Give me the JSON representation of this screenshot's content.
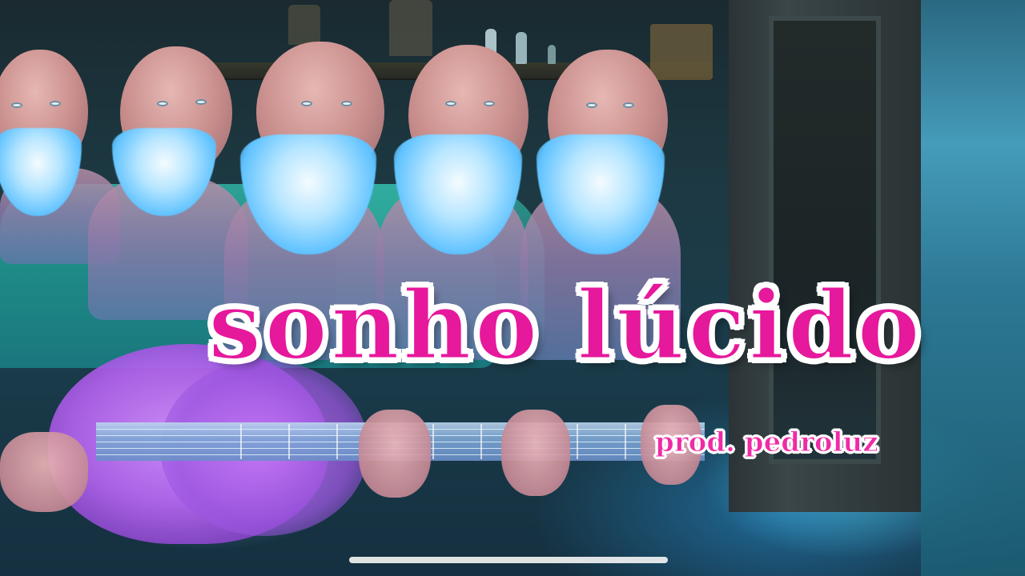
{
  "video": {
    "title": "sonho lúcido",
    "credit": "prod. pedroluz"
  },
  "colors": {
    "title_fill": "#e6189c",
    "title_outline": "#ffffff",
    "robe": "#2ea79a",
    "guitar": "#b463ef",
    "beard_glow": "#5fc2ff"
  },
  "system": {
    "home_indicator_icon": "home-indicator-bar"
  }
}
